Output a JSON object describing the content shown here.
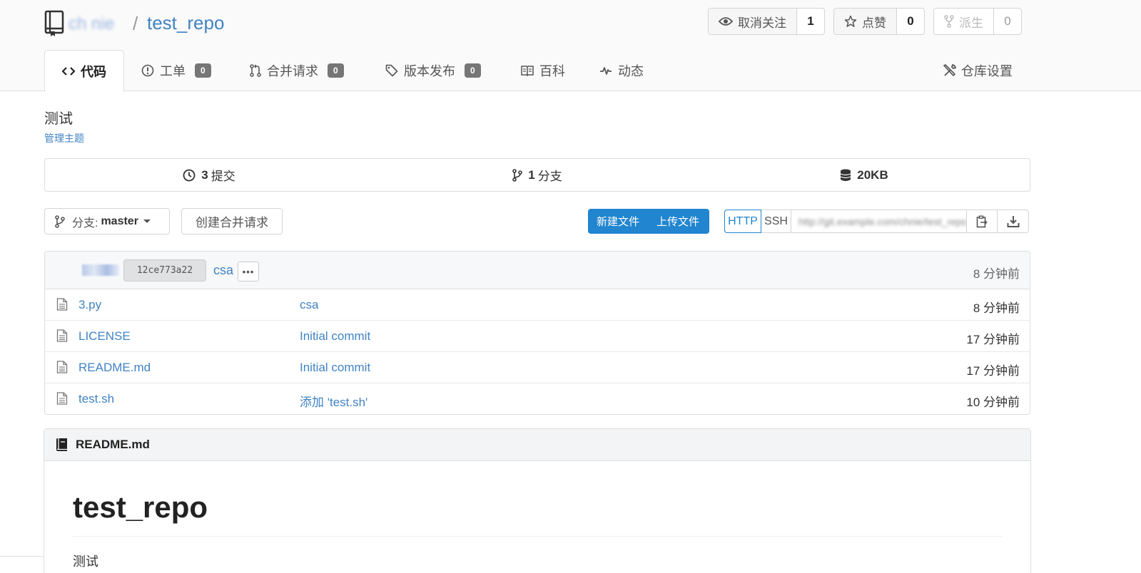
{
  "header": {
    "owner": "ch nie",
    "separator": "/",
    "repo_name": "test_repo",
    "watch": {
      "label": "取消关注",
      "count": "1"
    },
    "star": {
      "label": "点赞",
      "count": "0"
    },
    "fork": {
      "label": "派生",
      "count": "0"
    }
  },
  "tabs": {
    "code": "代码",
    "issues": {
      "label": "工单",
      "count": "0"
    },
    "pulls": {
      "label": "合并请求",
      "count": "0"
    },
    "releases": {
      "label": "版本发布",
      "count": "0"
    },
    "wiki": "百科",
    "activity": "动态",
    "settings": "仓库设置"
  },
  "repo": {
    "description": "测试",
    "manage_topics": "管理主题"
  },
  "stats": {
    "commits": {
      "count": "3",
      "label": "提交"
    },
    "branches": {
      "count": "1",
      "label": "分支"
    },
    "size": "20KB"
  },
  "toolbar": {
    "branch_prefix": "分支:",
    "branch_name": "master",
    "new_pr": "创建合并请求",
    "new_file": "新建文件",
    "upload_file": "上传文件",
    "clone_http": "HTTP",
    "clone_ssh": "SSH",
    "clone_url": "http://git.example.com/chnie/test_repo.git"
  },
  "latest_commit": {
    "sha": "12ce773a22",
    "message": "csa",
    "more": "•••",
    "time": "8 分钟前"
  },
  "files": [
    {
      "name": "3.py",
      "message": "csa",
      "time": "8 分钟前"
    },
    {
      "name": "LICENSE",
      "message": "Initial commit",
      "time": "17 分钟前"
    },
    {
      "name": "README.md",
      "message": "Initial commit",
      "time": "17 分钟前"
    },
    {
      "name": "test.sh",
      "message": "添加 'test.sh'",
      "time": "10 分钟前"
    }
  ],
  "readme": {
    "filename": "README.md",
    "title": "test_repo",
    "body": "测试"
  },
  "colors": {
    "link": "#4183c4",
    "primary": "#2185d0",
    "badge": "#767676"
  }
}
